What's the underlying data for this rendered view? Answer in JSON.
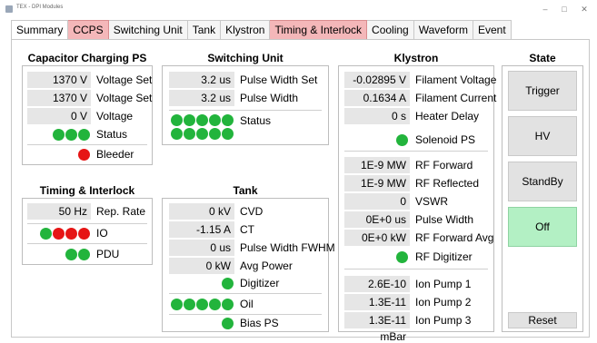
{
  "window": {
    "title": "TEX - DPI Modules",
    "minimize": "–",
    "maximize": "□",
    "close": "✕"
  },
  "tabs": [
    {
      "label": "Summary",
      "state": "active"
    },
    {
      "label": "CCPS",
      "state": "alarm"
    },
    {
      "label": "Switching Unit",
      "state": "normal"
    },
    {
      "label": "Tank",
      "state": "normal"
    },
    {
      "label": "Klystron",
      "state": "normal"
    },
    {
      "label": "Timing & Interlock",
      "state": "alarm"
    },
    {
      "label": "Cooling",
      "state": "normal"
    },
    {
      "label": "Waveform",
      "state": "normal"
    },
    {
      "label": "Event",
      "state": "normal"
    }
  ],
  "colors": {
    "led_green": "#22b43c",
    "led_red": "#e61515",
    "alarm_tab": "#f4b7b9",
    "off_button": "#b3f0c4"
  },
  "ccps": {
    "title": "Capacitor Charging PS",
    "voltage_set": {
      "value": "1370 V",
      "label": "Voltage Set"
    },
    "voltage_set2": {
      "value": "1370 V",
      "label": "Voltage Set"
    },
    "voltage": {
      "value": "0 V",
      "label": "Voltage"
    },
    "status": {
      "label": "Status",
      "leds": [
        "green",
        "green",
        "green"
      ]
    },
    "bleeder": {
      "label": "Bleeder",
      "leds": [
        "red"
      ]
    }
  },
  "switching": {
    "title": "Switching Unit",
    "pulse_width_set": {
      "value": "3.2 us",
      "label": "Pulse Width Set"
    },
    "pulse_width": {
      "value": "3.2 us",
      "label": "Pulse Width"
    },
    "status": {
      "label": "Status",
      "leds": [
        "green",
        "green",
        "green",
        "green",
        "green",
        "green",
        "green",
        "green",
        "green",
        "green"
      ]
    }
  },
  "timing": {
    "title": "Timing & Interlock",
    "rep_rate": {
      "value": "50 Hz",
      "label": "Rep. Rate"
    },
    "io": {
      "label": "IO",
      "leds": [
        "green",
        "red",
        "red",
        "red"
      ]
    },
    "pdu": {
      "label": "PDU",
      "leds": [
        "green",
        "green"
      ]
    }
  },
  "tank": {
    "title": "Tank",
    "cvd": {
      "value": "0 kV",
      "label": "CVD"
    },
    "ct": {
      "value": "-1.15 A",
      "label": "CT"
    },
    "pw_fwhm": {
      "value": "0 us",
      "label": "Pulse Width FWHM"
    },
    "avg_power": {
      "value": "0 kW",
      "label": "Avg Power"
    },
    "digitizer": {
      "label": "Digitizer",
      "leds": [
        "green"
      ]
    },
    "oil": {
      "label": "Oil",
      "leds": [
        "green",
        "green",
        "green",
        "green",
        "green"
      ]
    },
    "bias_ps": {
      "label": "Bias PS",
      "leds": [
        "green"
      ]
    }
  },
  "klystron": {
    "title": "Klystron",
    "filament_voltage": {
      "value": "-0.02895 V",
      "label": "Filament Voltage"
    },
    "filament_current": {
      "value": "0.1634 A",
      "label": "Filament Current"
    },
    "heater_delay": {
      "value": "0 s",
      "label": "Heater Delay"
    },
    "solenoid_ps": {
      "label": "Solenoid PS",
      "leds": [
        "green"
      ]
    },
    "rf_forward": {
      "value": "1E-9 MW",
      "label": "RF Forward"
    },
    "rf_reflected": {
      "value": "1E-9 MW",
      "label": "RF Reflected"
    },
    "vswr": {
      "value": "0",
      "label": "VSWR"
    },
    "pulse_width": {
      "value": "0E+0 us",
      "label": "Pulse Width"
    },
    "rf_forward_avg": {
      "value": "0E+0 kW",
      "label": "RF Forward Avg"
    },
    "rf_digitizer": {
      "label": "RF Digitizer",
      "leds": [
        "green"
      ]
    },
    "ion_pump_1": {
      "value": "2.6E-10 mBar",
      "label": "Ion Pump 1"
    },
    "ion_pump_2": {
      "value": "1.3E-11 mBar",
      "label": "Ion Pump 2"
    },
    "ion_pump_3": {
      "value": "1.3E-11 mBar",
      "label": "Ion Pump 3"
    }
  },
  "state": {
    "title": "State",
    "trigger": "Trigger",
    "hv": "HV",
    "standby": "StandBy",
    "off": "Off",
    "reset": "Reset"
  }
}
